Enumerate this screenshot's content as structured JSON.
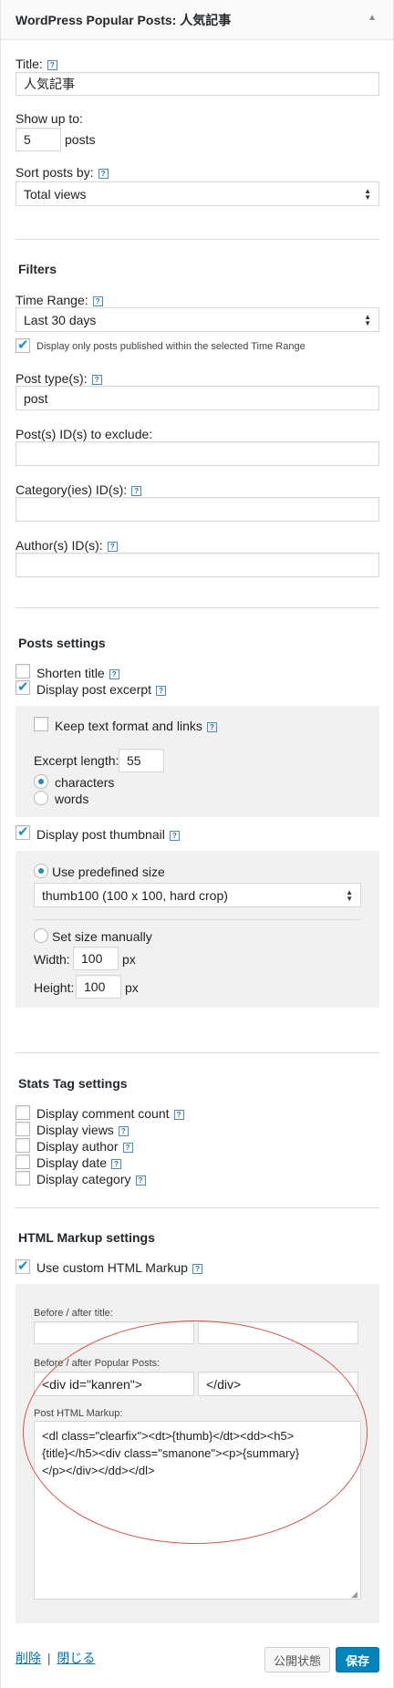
{
  "header": {
    "title": "WordPress Popular Posts: 人気記事",
    "toggle_glyph": "▲"
  },
  "title_field": {
    "label": "Title:",
    "value": "人気記事"
  },
  "show_up_to": {
    "label": "Show up to:",
    "value": "5",
    "suffix": "posts"
  },
  "sort": {
    "label": "Sort posts by:",
    "value": "Total views"
  },
  "filters": {
    "heading": "Filters",
    "time_range_label": "Time Range:",
    "time_range_value": "Last 30 days",
    "only_published_label": "Display only posts published within the selected Time Range",
    "post_types_label": "Post type(s):",
    "post_types_value": "post",
    "exclude_label": "Post(s) ID(s) to exclude:",
    "exclude_value": "",
    "category_label": "Category(ies) ID(s):",
    "category_value": "",
    "author_label": "Author(s) ID(s):",
    "author_value": ""
  },
  "posts_settings": {
    "heading": "Posts settings",
    "shorten_title": "Shorten title",
    "display_excerpt": "Display post excerpt",
    "keep_format": "Keep text format and links",
    "excerpt_length_label": "Excerpt length:",
    "excerpt_length_value": "55",
    "unit_characters": "characters",
    "unit_words": "words",
    "display_thumbnail": "Display post thumbnail",
    "use_predefined": "Use predefined size",
    "predefined_value": "thumb100 (100 x 100, hard crop)",
    "set_manually": "Set size manually",
    "width_label": "Width:",
    "width_value": "100",
    "height_label": "Height:",
    "height_value": "100",
    "px": "px"
  },
  "stats": {
    "heading": "Stats Tag settings",
    "comment_count": "Display comment count",
    "views": "Display views",
    "author": "Display author",
    "date": "Display date",
    "category": "Display category"
  },
  "html_markup": {
    "heading": "HTML Markup settings",
    "use_custom": "Use custom HTML Markup",
    "before_after_title_label": "Before / after title:",
    "before_title_value": "",
    "after_title_value": "",
    "before_after_popular_label": "Before / after Popular Posts:",
    "before_popular_value": "<div id=\"kanren\">",
    "after_popular_value": "</div>",
    "post_markup_label": "Post HTML Markup:",
    "post_markup_value": "<dl class=\"clearfix\"><dt>{thumb}</dt><dd><h5>\n{title}</h5><div class=\"smanone\"><p>{summary}\n</p></div></dd></dl>"
  },
  "footer": {
    "delete_link": "削除",
    "separator": "|",
    "close_link": "閉じる",
    "status_button": "公開状態",
    "save_button": "保存"
  },
  "colors": {
    "accent": "#0085ba",
    "annotation": "#d9534f",
    "link": "#0073aa"
  },
  "help_glyph": "?"
}
